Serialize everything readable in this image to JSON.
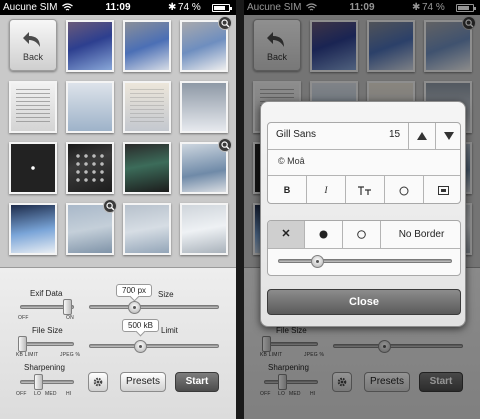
{
  "status": {
    "carrier": "Aucune SIM",
    "time": "11:09",
    "battery": "74 %",
    "battery_level": 0.74
  },
  "grid": {
    "back_label": "Back"
  },
  "controls": {
    "exif_label": "Exif Data",
    "exif_off": "OFF",
    "exif_on": "ON",
    "size_value": "700 px",
    "size_label": "Size",
    "filesize_label": "File Size",
    "filesize_left": "KB LIMIT",
    "filesize_right": "JPEG %",
    "limit_value": "500 kB",
    "limit_label": "Limit",
    "sharpening_label": "Sharpening",
    "sharp_ticks": [
      "OFF",
      "LO",
      "MED",
      "HI"
    ],
    "presets_label": "Presets",
    "start_label": "Start"
  },
  "watermark_popover": {
    "font_name": "Gill Sans",
    "font_size": "15",
    "text_value": "© Moâ",
    "style_buttons": [
      "B",
      "I"
    ],
    "border_label": "No Border",
    "close_label": "Close"
  },
  "colors": {
    "statusbar": "#000000",
    "panel": "#e6e6e6",
    "start_button": "#5a5a5a",
    "close_button": "#6a6a6a"
  }
}
